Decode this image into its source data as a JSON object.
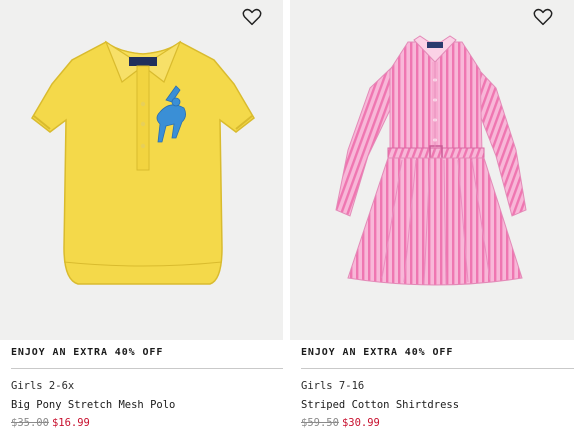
{
  "products": [
    {
      "promo": "ENJOY AN EXTRA 40% OFF",
      "category": "Girls 2-6x",
      "name": "Big Pony Stretch Mesh Polo",
      "original_price": "$35.00",
      "sale_price": "$16.99",
      "image_icon": "yellow-polo-shirt",
      "wishlist_icon": "heart-outline-icon"
    },
    {
      "promo": "ENJOY AN EXTRA 40% OFF",
      "category": "Girls 7-16",
      "name": "Striped Cotton Shirtdress",
      "original_price": "$59.50",
      "sale_price": "$30.99",
      "image_icon": "pink-striped-shirtdress",
      "wishlist_icon": "heart-outline-icon"
    }
  ],
  "colors": {
    "sale_red": "#c8102e",
    "strike_gray": "#8a8a8a",
    "image_bg": "#f0f0ef",
    "polo_yellow": "#f4d94a",
    "dress_pink": "#f48bc2"
  }
}
